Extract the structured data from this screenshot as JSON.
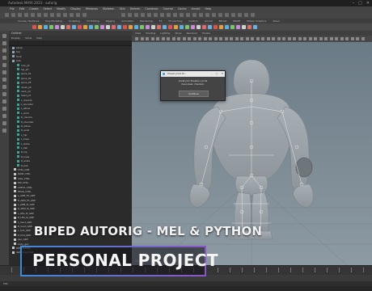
{
  "window": {
    "title": "Autodesk MAYA 2023 - autorig",
    "controls": [
      "–",
      "□",
      "✕"
    ]
  },
  "menubar": {
    "items": [
      "File",
      "Edit",
      "Create",
      "Select",
      "Modify",
      "Display",
      "Windows",
      "Skeleton",
      "Skin",
      "Deform",
      "Constrain",
      "Control",
      "Cache",
      "Arnold",
      "Help"
    ]
  },
  "shelf_tabs": [
    "Curves / Surfaces",
    "Poly Modeling",
    "Sculpting",
    "UV Editing",
    "Rigging",
    "Animation",
    "Rendering",
    "FX",
    "FX Caching",
    "Custom",
    "Arnold",
    "Bifrost",
    "MASH",
    "Motion Graphics",
    "XGen"
  ],
  "outliner": {
    "title": "Outliner",
    "menu": [
      "Display",
      "Show",
      "Help"
    ],
    "rows": [
      "persp",
      "top",
      "front",
      "side",
      "root_jnt",
      "hip_jnt",
      "spine_01",
      "spine_02",
      "spine_03",
      "chest_jnt",
      "neck_jnt",
      "head_jnt",
      "L_clavicle",
      "L_shoulder",
      "L_elbow",
      "L_wrist",
      "R_clavicle",
      "R_shoulder",
      "R_elbow",
      "R_wrist",
      "L_hip",
      "L_knee",
      "L_ankle",
      "L_ball",
      "R_hip",
      "R_knee",
      "R_ankle",
      "R_ball",
      "CTRL_GRP",
      "MAIN_CTRL",
      "COG_CTRL",
      "HIP_CTRL",
      "CHEST_CTRL",
      "HEAD_CTRL",
      "L_ARM_FK_GRP",
      "R_ARM_FK_GRP",
      "L_ARM_IK_GRP",
      "R_ARM_IK_GRP",
      "L_LEG_IK_GRP",
      "R_LEG_IK_GRP",
      "L_hand_GRP",
      "R_hand_GRP",
      "L_foot_GRP",
      "R_foot_GRP",
      "geo_GRP",
      "body_geo",
      "DEFORMERS",
      "defaultLightSet"
    ]
  },
  "viewport": {
    "menu": [
      "View",
      "Shading",
      "Lighting",
      "Show",
      "Renderer",
      "Panels"
    ],
    "label": "persp"
  },
  "dialog": {
    "title": "Check Joint Or...",
    "message_line1": "Great job! Skeleton joints",
    "message_line2": "have been checked.",
    "button": "Continue"
  },
  "cmdline": {
    "label": "MEL"
  },
  "captions": {
    "line1": "BIPED AUTORIG - MEL & PYTHON",
    "line2": "PERSONAL PROJECT"
  },
  "colors": {
    "frame_start": "#3d8ad8",
    "frame_end": "#8a56c6",
    "viewport_bg": "#7b8993",
    "joint_icon": "#3aa39a"
  }
}
